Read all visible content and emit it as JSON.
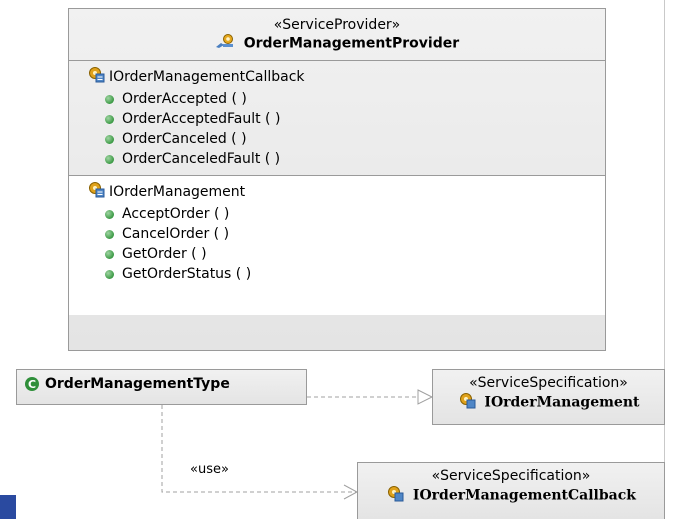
{
  "provider": {
    "stereotype": "«ServiceProvider»",
    "name": "OrderManagementProvider",
    "icon": "service-provider-icon",
    "compartments": [
      {
        "interface": "IOrderManagementCallback",
        "operations": [
          "OrderAccepted ( )",
          "OrderAcceptedFault ( )",
          "OrderCanceled ( )",
          "OrderCanceledFault ( )"
        ]
      },
      {
        "interface": "IOrderManagement",
        "operations": [
          "AcceptOrder ( )",
          "CancelOrder ( )",
          "GetOrder ( )",
          "GetOrderStatus ( )"
        ]
      }
    ]
  },
  "type_class": {
    "icon_letter": "C",
    "name": "OrderManagementType"
  },
  "spec_management": {
    "stereotype": "«ServiceSpecification»",
    "name": "IOrderManagement"
  },
  "spec_callback": {
    "stereotype": "«ServiceSpecification»",
    "name": "IOrderManagementCallback"
  },
  "use_label": "«use»",
  "colors": {
    "border": "#9a9a9a",
    "dot_green": "#3c9a45",
    "connector": "#a0a0a0",
    "accent_blue": "#2a4aa0"
  }
}
